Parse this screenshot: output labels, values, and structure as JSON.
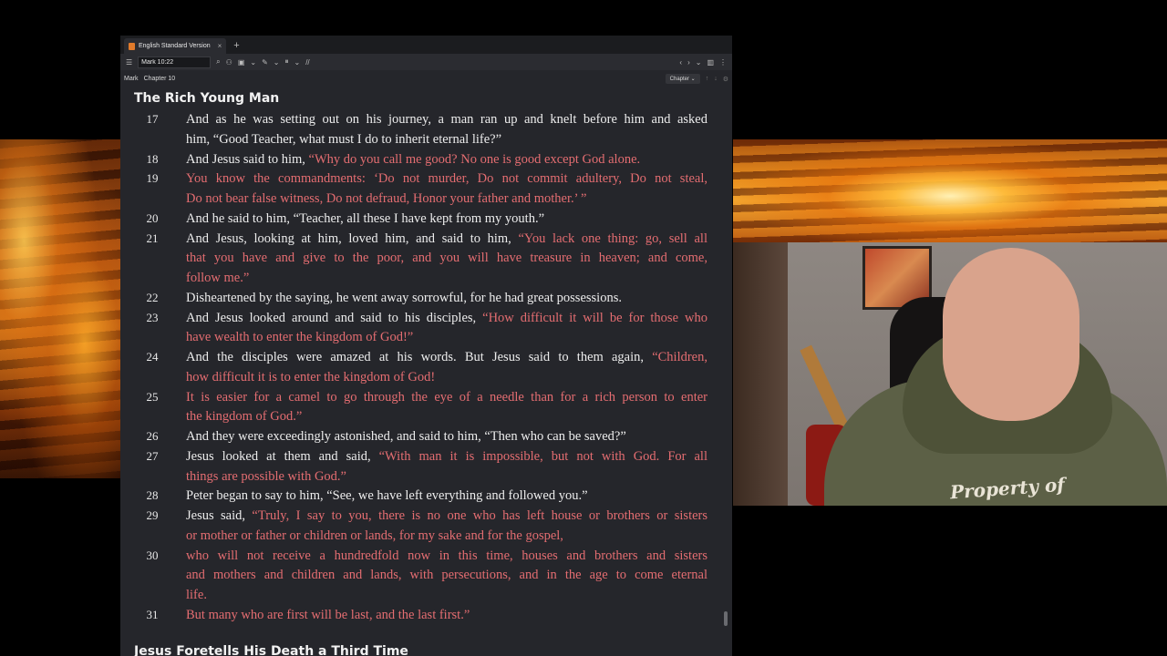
{
  "window": {
    "tab_title": "English Standard Version",
    "tab_close": "×",
    "new_tab": "+"
  },
  "toolbar": {
    "reference_value": "Mark 10:22",
    "menu_icon": "hamburger-icon",
    "icons": [
      "search-icon",
      "people-icon",
      "bookmark-icon",
      "highlight-icon",
      "columns-icon",
      "parallel-icon"
    ],
    "parallel_label": "//",
    "nav_back": "‹",
    "nav_forward": "›"
  },
  "breadcrumb": {
    "book": "Mark",
    "chapter": "Chapter 10",
    "chapter_dropdown": "Chapter"
  },
  "passage": {
    "heading": "The Rich Young Man",
    "next_heading": "Jesus Foretells His Death a Third Time",
    "verses": [
      {
        "num": "17",
        "lines": [
          {
            "segs": [
              {
                "t": "And as he was setting out on his journey, a man ran up and knelt before him and asked",
                "r": false
              }
            ],
            "j": true
          },
          {
            "segs": [
              {
                "t": "him, “Good Teacher, what must I do to inherit eternal life?”",
                "r": false
              }
            ],
            "j": false
          }
        ]
      },
      {
        "num": "18",
        "lines": [
          {
            "segs": [
              {
                "t": "And Jesus said to him, ",
                "r": false
              },
              {
                "t": "“Why do you call me good? No one is good except God alone.",
                "r": true
              }
            ],
            "j": false
          }
        ]
      },
      {
        "num": "19",
        "lines": [
          {
            "segs": [
              {
                "t": "You know the commandments: ‘Do not murder, Do not commit adultery, Do not steal,",
                "r": true
              }
            ],
            "j": true
          },
          {
            "segs": [
              {
                "t": "Do not bear false witness, Do not defraud, Honor your father and mother.’ ”",
                "r": true
              }
            ],
            "j": false
          }
        ]
      },
      {
        "num": "20",
        "lines": [
          {
            "segs": [
              {
                "t": "And he said to him, “Teacher, all these I have kept from my youth.”",
                "r": false
              }
            ],
            "j": false
          }
        ]
      },
      {
        "num": "21",
        "lines": [
          {
            "segs": [
              {
                "t": "And Jesus, looking at him, loved him, and said to him, ",
                "r": false
              },
              {
                "t": "“You lack one thing: go, sell all",
                "r": true
              }
            ],
            "j": true
          },
          {
            "segs": [
              {
                "t": "that you have and give to the poor, and you will have treasure in heaven; and come,",
                "r": true
              }
            ],
            "j": true
          },
          {
            "segs": [
              {
                "t": "follow me.”",
                "r": true
              }
            ],
            "j": false
          }
        ]
      },
      {
        "num": "22",
        "lines": [
          {
            "segs": [
              {
                "t": "Disheartened by the saying, he went away sorrowful, for he had great possessions.",
                "r": false
              }
            ],
            "j": false
          }
        ]
      },
      {
        "num": "23",
        "lines": [
          {
            "segs": [
              {
                "t": "And Jesus looked around and said to his disciples, ",
                "r": false
              },
              {
                "t": "“How difficult it will be for those who",
                "r": true
              }
            ],
            "j": true
          },
          {
            "segs": [
              {
                "t": "have wealth to enter the kingdom of God!”",
                "r": true
              }
            ],
            "j": false
          }
        ]
      },
      {
        "num": "24",
        "lines": [
          {
            "segs": [
              {
                "t": "And the disciples were amazed at his words. But Jesus said to them again, ",
                "r": false
              },
              {
                "t": "“Children,",
                "r": true
              }
            ],
            "j": true
          },
          {
            "segs": [
              {
                "t": "how difficult it is to enter the kingdom of God!",
                "r": true
              }
            ],
            "j": false
          }
        ]
      },
      {
        "num": "25",
        "lines": [
          {
            "segs": [
              {
                "t": "It is easier for a camel to go through the eye of a needle than for a rich person to enter",
                "r": true
              }
            ],
            "j": true
          },
          {
            "segs": [
              {
                "t": "the kingdom of God.”",
                "r": true
              }
            ],
            "j": false
          }
        ]
      },
      {
        "num": "26",
        "lines": [
          {
            "segs": [
              {
                "t": "And they were exceedingly astonished, and said to him, “Then who can be saved?”",
                "r": false
              }
            ],
            "j": false
          }
        ]
      },
      {
        "num": "27",
        "lines": [
          {
            "segs": [
              {
                "t": "Jesus looked at them and said, ",
                "r": false
              },
              {
                "t": "“With man it is impossible, but not with God. For all",
                "r": true
              }
            ],
            "j": true
          },
          {
            "segs": [
              {
                "t": "things are possible with God.”",
                "r": true
              }
            ],
            "j": false
          }
        ]
      },
      {
        "num": "28",
        "lines": [
          {
            "segs": [
              {
                "t": "Peter began to say to him, “See, we have left everything and followed you.”",
                "r": false
              }
            ],
            "j": false
          }
        ]
      },
      {
        "num": "29",
        "lines": [
          {
            "segs": [
              {
                "t": "Jesus said, ",
                "r": false
              },
              {
                "t": "“Truly, I say to you, there is no one who has left house or brothers or sisters",
                "r": true
              }
            ],
            "j": true
          },
          {
            "segs": [
              {
                "t": "or mother or father or children or lands, for my sake and for the gospel,",
                "r": true
              }
            ],
            "j": false
          }
        ]
      },
      {
        "num": "30",
        "lines": [
          {
            "segs": [
              {
                "t": "who will not receive a hundredfold now in this time, houses and brothers and sisters",
                "r": true
              }
            ],
            "j": true
          },
          {
            "segs": [
              {
                "t": "and mothers and children and lands, with persecutions, and in the age to come eternal",
                "r": true
              }
            ],
            "j": true
          },
          {
            "segs": [
              {
                "t": "life.",
                "r": true
              }
            ],
            "j": false
          }
        ]
      },
      {
        "num": "31",
        "lines": [
          {
            "segs": [
              {
                "t": "But many who are first will be last, and the last first.”",
                "r": true
              }
            ],
            "j": false
          }
        ]
      }
    ]
  },
  "webcam": {
    "shirt_text": "Property of"
  },
  "colors": {
    "words_of_christ": "#e46d71",
    "text": "#ededed",
    "background": "#25262b"
  }
}
